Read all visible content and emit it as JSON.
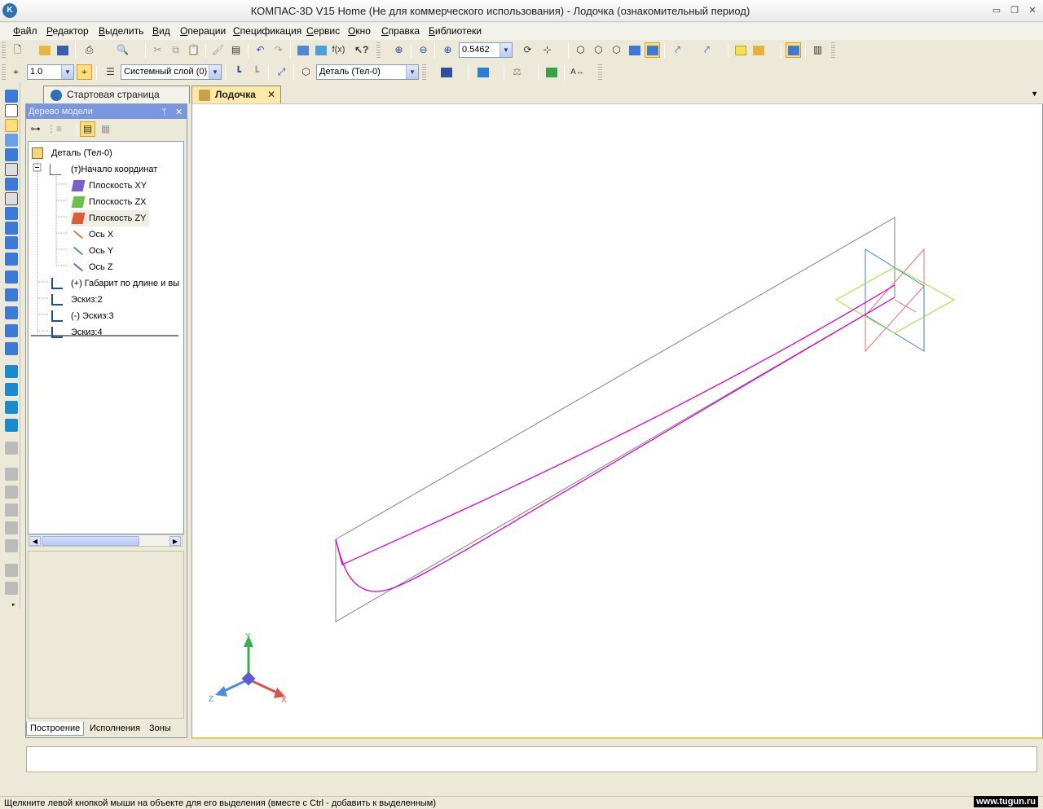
{
  "window": {
    "title": "КОМПАС-3D V15 Home (Не для коммерческого использования) - Лодочка (ознакомительный период)",
    "app_icon": "kompas-logo-icon",
    "controls": [
      "minimize-icon",
      "restore-icon",
      "close-icon"
    ]
  },
  "menu": [
    {
      "u": "Ф",
      "rest": "айл"
    },
    {
      "u": "Р",
      "rest": "едактор"
    },
    {
      "u": "В",
      "rest": "ыделить"
    },
    {
      "u": "В",
      "rest": "ид"
    },
    {
      "u": "О",
      "rest": "перации"
    },
    {
      "u": "С",
      "rest": "пецификация"
    },
    {
      "u": "С",
      "rest": "ервис"
    },
    {
      "u": "О",
      "rest": "кно"
    },
    {
      "u": "С",
      "rest": "правка"
    },
    {
      "u": "Б",
      "rest": "иблиотеки"
    }
  ],
  "toolbar": {
    "zoom_value": "0.5462",
    "step_value": "1.0",
    "layer_value": "Системный слой (0)",
    "detail_value": "Деталь (Тел-0)"
  },
  "tabs": {
    "start": "Стартовая страница",
    "doc": "Лодочка",
    "close": "✕"
  },
  "tree": {
    "header": "Дерево модели",
    "pin": "ᛘ",
    "close": "✕",
    "rows": [
      "Деталь (Тел-0)",
      "(т)Начало координат",
      "Плоскость XY",
      "Плоскость ZX",
      "Плоскость ZY",
      "Ось X",
      "Ось Y",
      "Ось Z",
      "(+) Габарит по длине и вы",
      "Эскиз:2",
      "(-) Эскиз:3",
      "Эскиз:4"
    ],
    "bottom_tabs": [
      "Построение",
      "Исполнения",
      "Зоны"
    ]
  },
  "viewport": {
    "axis_labels": {
      "x": "X",
      "y": "Y",
      "z": "Z"
    },
    "colors": {
      "profile": "#e000d8",
      "frame": "#808080",
      "plane_xy": "#3a7fd6",
      "plane_zx": "#9be02e",
      "plane_zy": "#e8707a"
    }
  },
  "status": {
    "hint": "Щелкните левой кнопкой мыши на объекте для его выделения (вместе с Ctrl - добавить к выделенным)",
    "watermark": "www.tugun.ru"
  }
}
